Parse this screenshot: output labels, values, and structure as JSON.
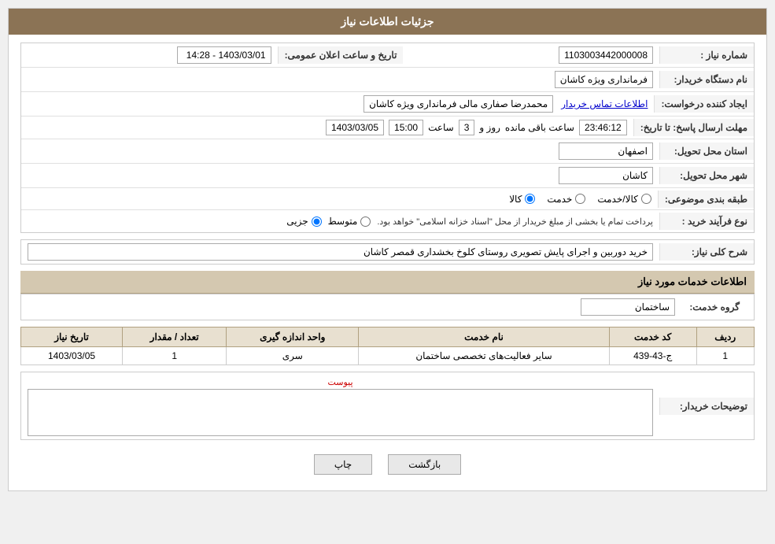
{
  "header": {
    "title": "جزئیات اطلاعات نیاز"
  },
  "fields": {
    "need_number_label": "شماره نیاز :",
    "need_number_value": "1103003442000008",
    "buyer_org_label": "نام دستگاه خریدار:",
    "buyer_org_value": "فرمانداری ویژه کاشان",
    "requester_label": "ایجاد کننده درخواست:",
    "requester_value": "محمدرضا صفاری مالی فرمانداری ویژه کاشان",
    "contact_info_link": "اطلاعات تماس خریدار",
    "response_deadline_label": "مهلت ارسال پاسخ: تا تاریخ:",
    "announcement_date_label": "تاریخ و ساعت اعلان عمومی:",
    "announcement_date_value": "1403/03/01 - 14:28",
    "date_value": "1403/03/05",
    "time_label": "ساعت",
    "time_value": "15:00",
    "days_label": "روز و",
    "days_value": "3",
    "remaining_label": "ساعت باقی مانده",
    "remaining_value": "23:46:12",
    "province_label": "استان محل تحویل:",
    "province_value": "اصفهان",
    "city_label": "شهر محل تحویل:",
    "city_value": "کاشان",
    "subject_label": "طبقه بندی موضوعی:",
    "subject_options": [
      "کالا",
      "خدمت",
      "کالا/خدمت"
    ],
    "subject_selected": "کالا",
    "purchase_type_label": "نوع فرآیند خرید :",
    "purchase_options": [
      "جزیی",
      "متوسط"
    ],
    "purchase_note": "پرداخت تمام یا بخشی از مبلغ خریدار از محل \"اسناد خزانه اسلامی\" خواهد بود.",
    "description_label": "شرح کلی نیاز:",
    "description_value": "خرید دوربین و اجرای پایش تصویری روستای کلوخ بخشداری قمصر کاشان",
    "service_info_label": "اطلاعات خدمات مورد نیاز",
    "service_group_label": "گروه خدمت:",
    "service_group_value": "ساختمان",
    "table_headers": [
      "ردیف",
      "کد خدمت",
      "نام خدمت",
      "واحد اندازه گیری",
      "تعداد / مقدار",
      "تاریخ نیاز"
    ],
    "table_rows": [
      {
        "row": "1",
        "code": "ج-43-439",
        "name": "سایر فعالیت‌های تخصصی ساختمان",
        "unit": "سری",
        "quantity": "1",
        "date": "1403/03/05"
      }
    ],
    "attachment_label": "پیوست",
    "buyer_notes_label": "توضیحات خریدار:",
    "buyer_notes_value": ""
  },
  "buttons": {
    "back_label": "بازگشت",
    "print_label": "چاپ"
  }
}
